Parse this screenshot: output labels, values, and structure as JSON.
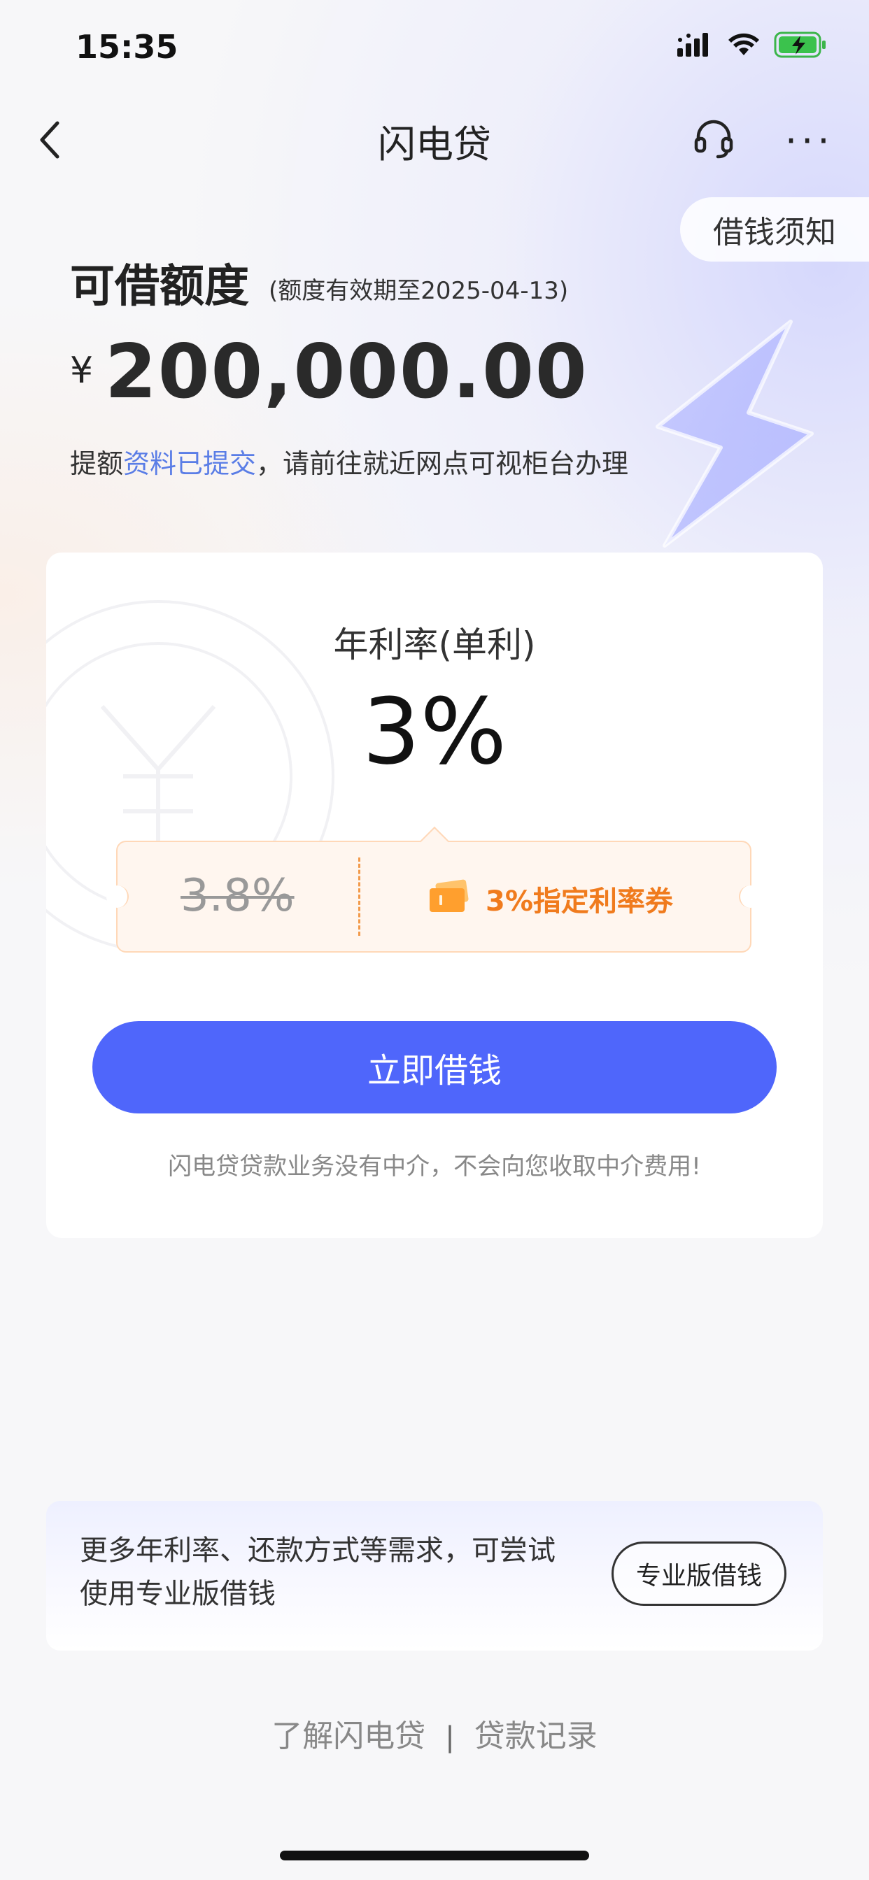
{
  "status_bar": {
    "time": "15:35"
  },
  "nav": {
    "title": "闪电贷"
  },
  "notice_button": "借钱须知",
  "credit": {
    "title": "可借额度",
    "validity": "(额度有效期至2025-04-13)",
    "currency": "¥",
    "amount": "200,000.00",
    "desc_prefix": "提额",
    "desc_link": "资料已提交",
    "desc_suffix": "，请前往就近网点可视柜台办理"
  },
  "rate_card": {
    "label": "年利率(单利)",
    "value": "3%",
    "old_rate": "3.8%",
    "coupon_text": "3%指定利率券",
    "borrow_button": "立即借钱",
    "disclaimer": "闪电贷贷款业务没有中介，不会向您收取中介费用!"
  },
  "promo": {
    "text": "更多年利率、还款方式等需求，可尝试使用专业版借钱",
    "button": "专业版借钱"
  },
  "footer": {
    "link1": "了解闪电贷",
    "separator": "|",
    "link2": "贷款记录"
  },
  "colors": {
    "primary": "#4f66fb",
    "coupon_accent": "#f07b1d",
    "link": "#5a7de6"
  },
  "icons": [
    "signal-icon",
    "wifi-icon",
    "battery-charging-icon",
    "back-icon",
    "headset-icon",
    "more-icon",
    "lightning-bolt-icon",
    "ticket-icon"
  ]
}
